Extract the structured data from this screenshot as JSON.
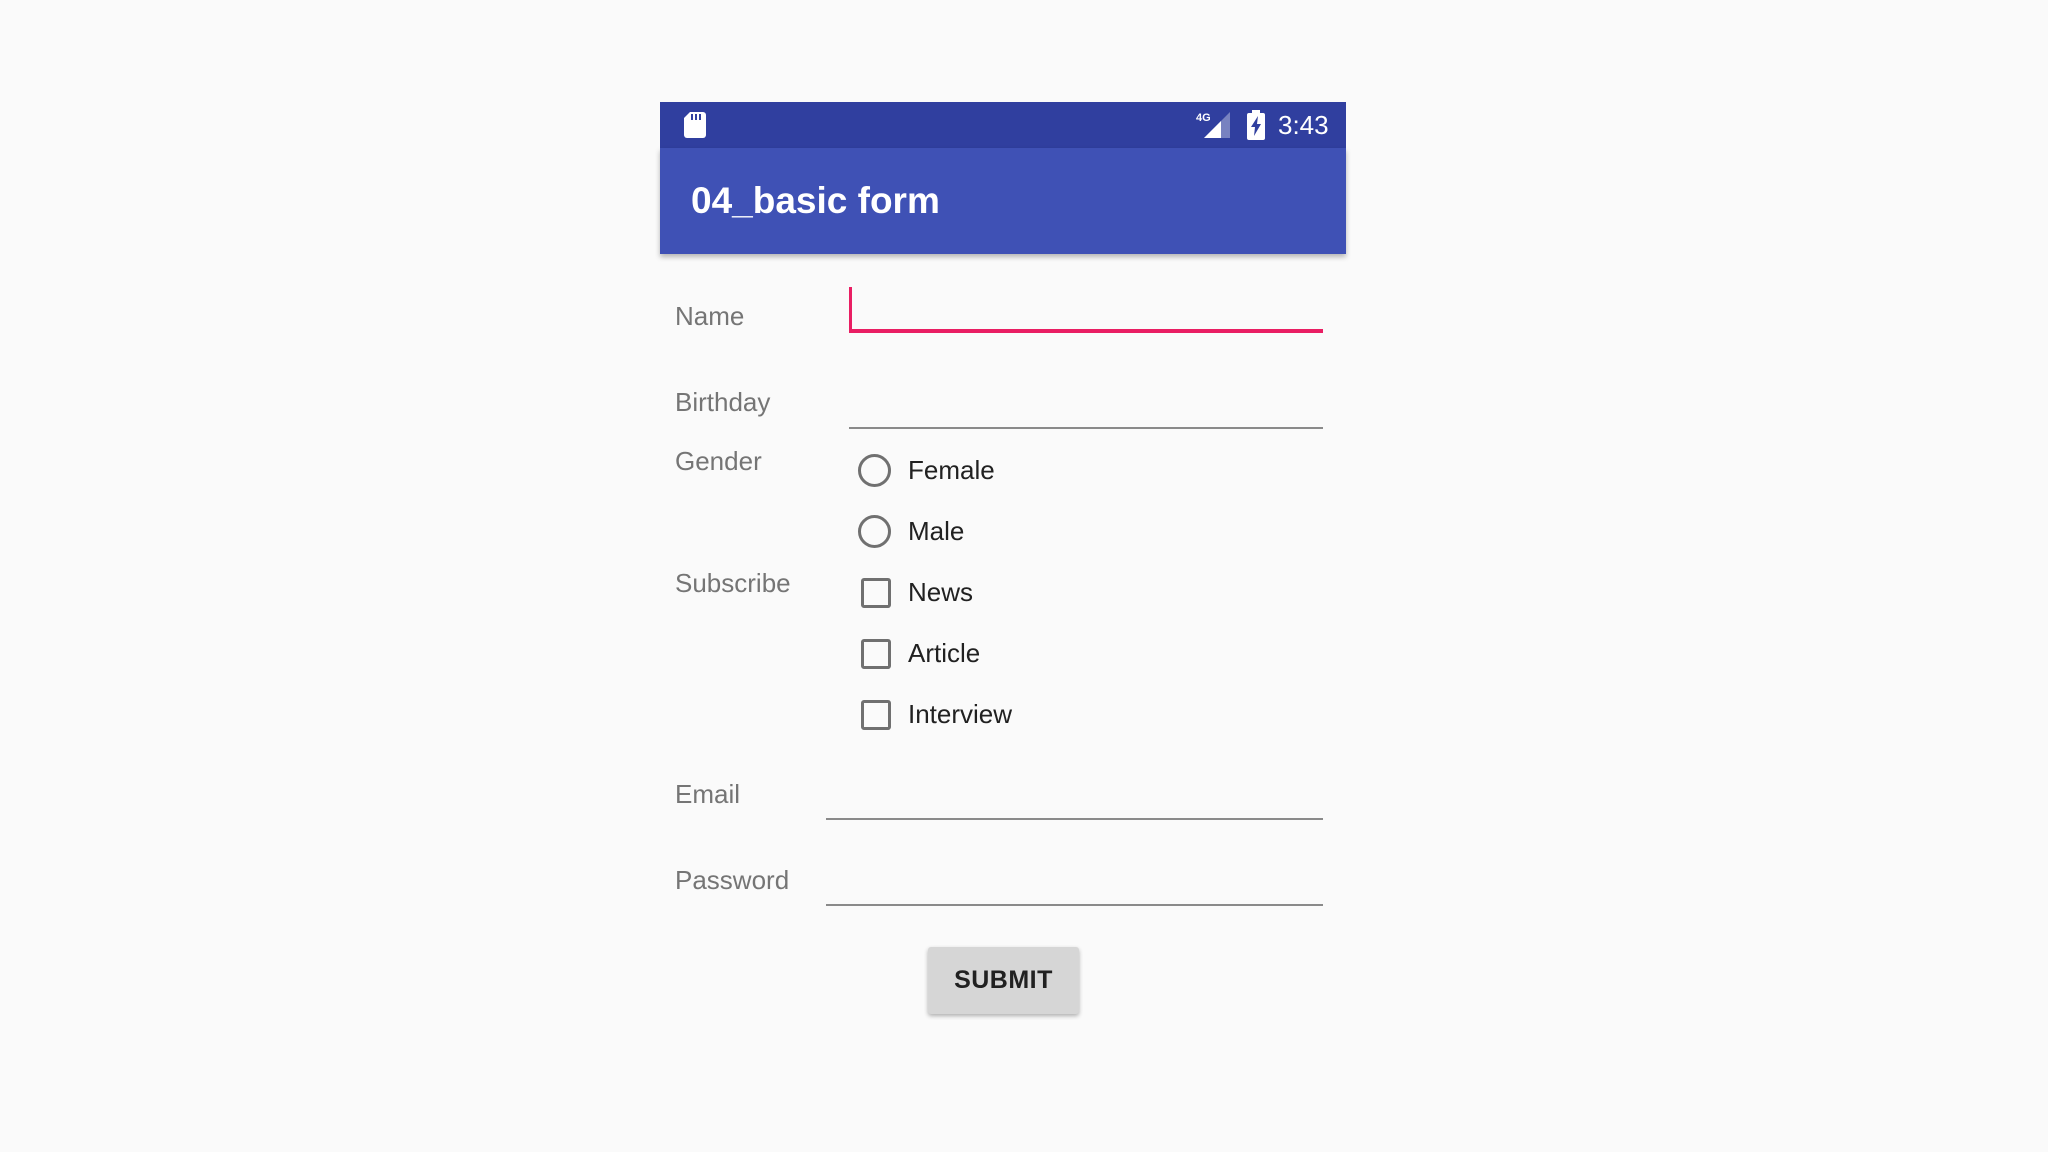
{
  "status_bar": {
    "time": "3:43",
    "network_label": "4G",
    "icons": [
      "sd-card-icon",
      "signal-icon",
      "battery-charging-icon"
    ]
  },
  "app_bar": {
    "title": "04_basic form"
  },
  "form": {
    "name": {
      "label": "Name",
      "value": ""
    },
    "birthday": {
      "label": "Birthday",
      "value": ""
    },
    "gender": {
      "label": "Gender",
      "options": [
        {
          "label": "Female",
          "selected": false
        },
        {
          "label": "Male",
          "selected": false
        }
      ]
    },
    "subscribe": {
      "label": "Subscribe",
      "options": [
        {
          "label": "News",
          "checked": false
        },
        {
          "label": "Article",
          "checked": false
        },
        {
          "label": "Interview",
          "checked": false
        }
      ]
    },
    "email": {
      "label": "Email",
      "value": ""
    },
    "password": {
      "label": "Password",
      "value": ""
    },
    "submit_label": "SUBMIT"
  },
  "colors": {
    "status_bar": "#303f9f",
    "app_bar": "#3f51b5",
    "accent": "#e91e63",
    "background": "#fafafa"
  }
}
